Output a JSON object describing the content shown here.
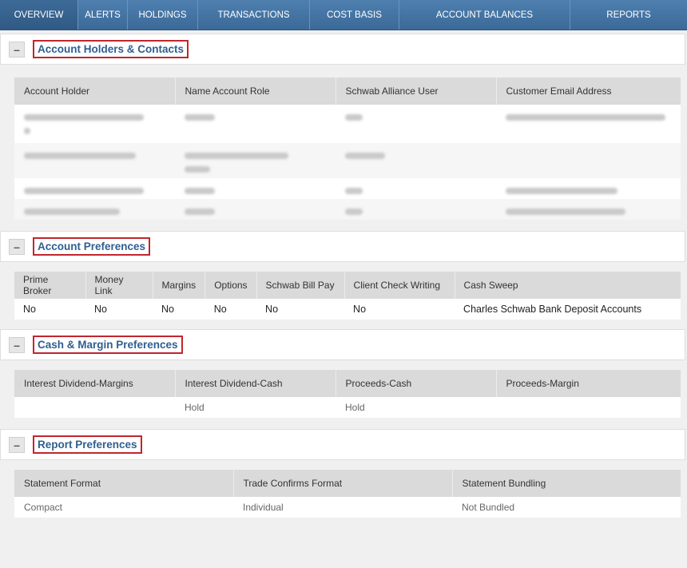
{
  "tabs": [
    "OVERVIEW",
    "ALERTS",
    "HOLDINGS",
    "TRANSACTIONS",
    "COST BASIS",
    "ACCOUNT BALANCES",
    "REPORTS"
  ],
  "collapse_symbol": "–",
  "holders": {
    "title": "Account Holders & Contacts",
    "headers": [
      "Account Holder",
      "Name Account Role",
      "Schwab Alliance User",
      "Customer Email Address"
    ]
  },
  "account_prefs": {
    "title": "Account Preferences",
    "headers": [
      "Prime Broker",
      "Money Link",
      "Margins",
      "Options",
      "Schwab Bill Pay",
      "Client Check Writing",
      "Cash Sweep"
    ],
    "values": [
      "No",
      "No",
      "No",
      "No",
      "No",
      "No",
      "Charles Schwab Bank Deposit Accounts"
    ]
  },
  "cash_margin": {
    "title": "Cash & Margin Preferences",
    "headers": [
      "Interest Dividend-Margins",
      "Interest Dividend-Cash",
      "Proceeds-Cash",
      "Proceeds-Margin"
    ],
    "values": [
      "",
      "Hold",
      "Hold",
      ""
    ]
  },
  "report_prefs": {
    "title": "Report Preferences",
    "headers": [
      "Statement Format",
      "Trade Confirms Format",
      "Statement Bundling"
    ],
    "values": [
      "Compact",
      "Individual",
      "Not Bundled"
    ]
  },
  "colors": {
    "tab_bar": "#4f7fae",
    "title_text": "#2f5f8f",
    "highlight_box": "#c0262d"
  }
}
